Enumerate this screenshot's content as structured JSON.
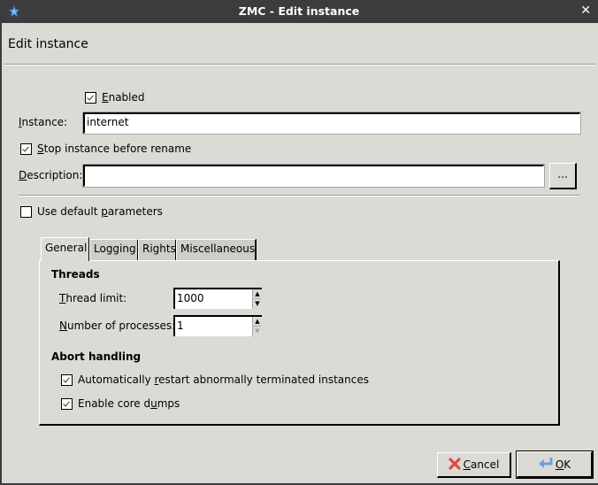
{
  "window": {
    "title": "ZMC - Edit instance",
    "close_icon": "close-icon",
    "app_icon": "zmc-logo-icon"
  },
  "page_title": "Edit instance",
  "form": {
    "enabled": {
      "label_underline": "E",
      "label_rest": "nabled",
      "checked": true
    },
    "instance": {
      "label_underline": "I",
      "label_rest": "nstance:",
      "value": "internet"
    },
    "stop_before_rename": {
      "label_underline": "S",
      "label_rest": "top instance before rename",
      "checked": true
    },
    "description": {
      "label_underline": "D",
      "label_rest": "escription:",
      "value": "",
      "browse_label": "..."
    },
    "use_default_parameters": {
      "label_pre": "Use default ",
      "label_underline": "p",
      "label_rest": "arameters",
      "checked": false
    }
  },
  "tabs": [
    {
      "label": "General",
      "active": true
    },
    {
      "label": "Logging",
      "active": false
    },
    {
      "label": "Rights",
      "active": false
    },
    {
      "label": "Miscellaneous",
      "active": false
    }
  ],
  "general": {
    "threads_title": "Threads",
    "thread_limit": {
      "label_underline": "T",
      "label_rest": "hread limit:",
      "value": "1000"
    },
    "num_processes": {
      "label_underline": "N",
      "label_rest": "umber of processes:",
      "value": "1"
    },
    "abort_title": "Abort handling",
    "auto_restart": {
      "label_pre": "Automatically ",
      "label_underline": "r",
      "label_rest": "estart abnormally terminated instances",
      "checked": true
    },
    "core_dumps": {
      "label_pre": "Enable core d",
      "label_underline": "u",
      "label_rest": "mps",
      "checked": true
    }
  },
  "buttons": {
    "cancel": {
      "label_underline": "C",
      "label_rest": "ancel",
      "icon": "red-x-icon"
    },
    "ok": {
      "label_underline": "O",
      "label_rest": "K",
      "icon": "return-arrow-icon"
    }
  }
}
